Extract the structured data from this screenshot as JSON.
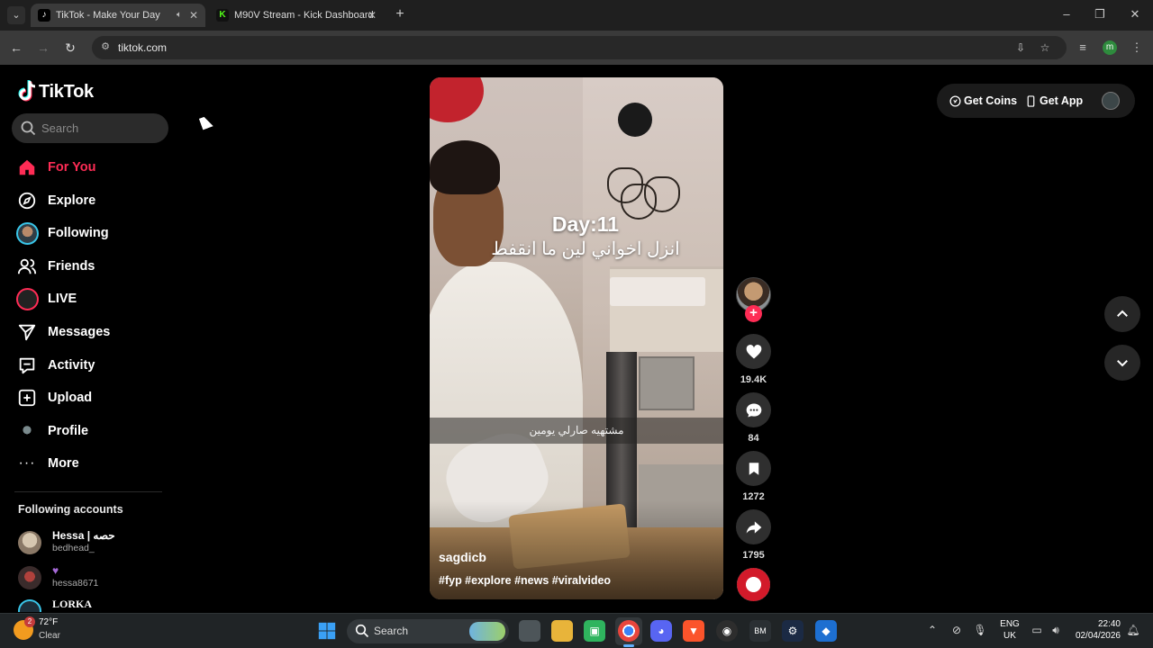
{
  "browser": {
    "tabs": [
      {
        "title": "TikTok - Make Your Day",
        "active": true
      },
      {
        "title": "M90V Stream - Kick Dashboard",
        "active": false
      }
    ],
    "url": "tiktok.com",
    "profile_initial": "m"
  },
  "tiktok": {
    "logo_text": "TikTok",
    "search_placeholder": "Search",
    "nav": [
      {
        "label": "For You",
        "icon": "home-icon",
        "active": true
      },
      {
        "label": "Explore",
        "icon": "compass-icon"
      },
      {
        "label": "Following",
        "icon": "following-avatar-icon"
      },
      {
        "label": "Friends",
        "icon": "friends-icon"
      },
      {
        "label": "LIVE",
        "icon": "live-icon"
      },
      {
        "label": "Messages",
        "icon": "paper-plane-icon"
      },
      {
        "label": "Activity",
        "icon": "activity-icon"
      },
      {
        "label": "Upload",
        "icon": "plus-square-icon"
      },
      {
        "label": "Profile",
        "icon": "profile-avatar-icon"
      },
      {
        "label": "More",
        "icon": "more-dots-icon"
      }
    ],
    "following_title": "Following accounts",
    "following": [
      {
        "name": "Hessa | حصه",
        "username": "bedhead_"
      },
      {
        "name": "",
        "username": "hessa8671"
      },
      {
        "name": "LORKA",
        "username": ""
      }
    ],
    "top_right": {
      "get_coins": "Get Coins",
      "get_app": "Get App"
    },
    "video": {
      "overlay_title": "Day:11",
      "overlay_arabic": "انزل اخواني لين ما انقفط",
      "caption": "مشتهيه صارلي يومين",
      "author": "sagdicb",
      "hashtags": "#fyp #explore #news #viralvideo"
    },
    "actions": {
      "likes": "19.4K",
      "comments": "84",
      "saves": "1272",
      "shares": "1795"
    }
  },
  "taskbar": {
    "weather_temp": "72°F",
    "weather_cond": "Clear",
    "weather_badge": "2",
    "search_label": "Search",
    "lang_top": "ENG",
    "lang_bottom": "UK",
    "time": "22:40",
    "date": "02/04/2026"
  },
  "colors": {
    "accent": "#fe2c55",
    "background": "#000000",
    "kick_green": "#53fc18"
  }
}
